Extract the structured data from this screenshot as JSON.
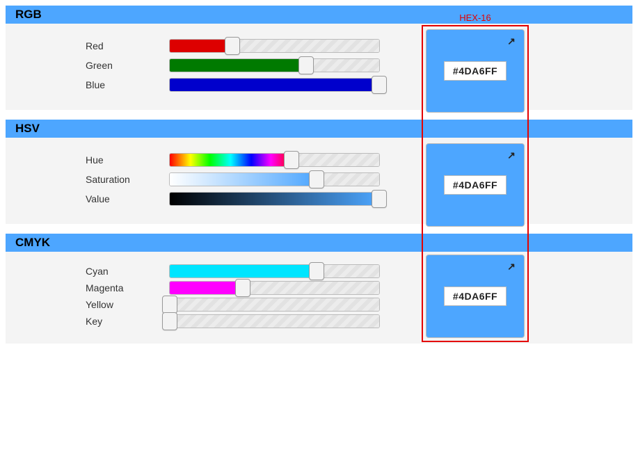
{
  "colors": {
    "accent": "#4DA6FF",
    "highlight": "#e40000"
  },
  "highlight": {
    "label": "HEX-16"
  },
  "rgb": {
    "title": "RGB",
    "hex": "#4DA6FF",
    "sliders": [
      {
        "label": "Red",
        "pct": 30,
        "fill": "linear-gradient(#d00,#d00)"
      },
      {
        "label": "Green",
        "pct": 65,
        "fill": "linear-gradient(#007a00,#007a00)"
      },
      {
        "label": "Blue",
        "pct": 100,
        "fill": "linear-gradient(#0000cc,#0000cc)"
      }
    ]
  },
  "hsv": {
    "title": "HSV",
    "hex": "#4DA6FF",
    "sliders": [
      {
        "label": "Hue",
        "pct": 58,
        "fill": "linear-gradient(90deg,#ff0000 0%,#ffff00 17%,#00ff00 33%,#00ffff 50%,#0000ff 67%,#ff00ff 83%,#ff0000 100%)"
      },
      {
        "label": "Saturation",
        "pct": 70,
        "fill": "linear-gradient(90deg,#ffffff 0%,#4DA6FF 100%)"
      },
      {
        "label": "Value",
        "pct": 100,
        "fill": "linear-gradient(90deg,#000000 0%,#4DA6FF 100%)"
      }
    ]
  },
  "cmyk": {
    "title": "CMYK",
    "hex": "#4DA6FF",
    "sliders": [
      {
        "label": "Cyan",
        "pct": 70,
        "fill": "linear-gradient(#00e5ff,#00e5ff)"
      },
      {
        "label": "Magenta",
        "pct": 35,
        "fill": "linear-gradient(#ff00ff,#ff00ff)"
      },
      {
        "label": "Yellow",
        "pct": 0,
        "fill": "linear-gradient(#ffff00,#ffff00)"
      },
      {
        "label": "Key",
        "pct": 0,
        "fill": "linear-gradient(#000000,#000000)"
      }
    ]
  }
}
